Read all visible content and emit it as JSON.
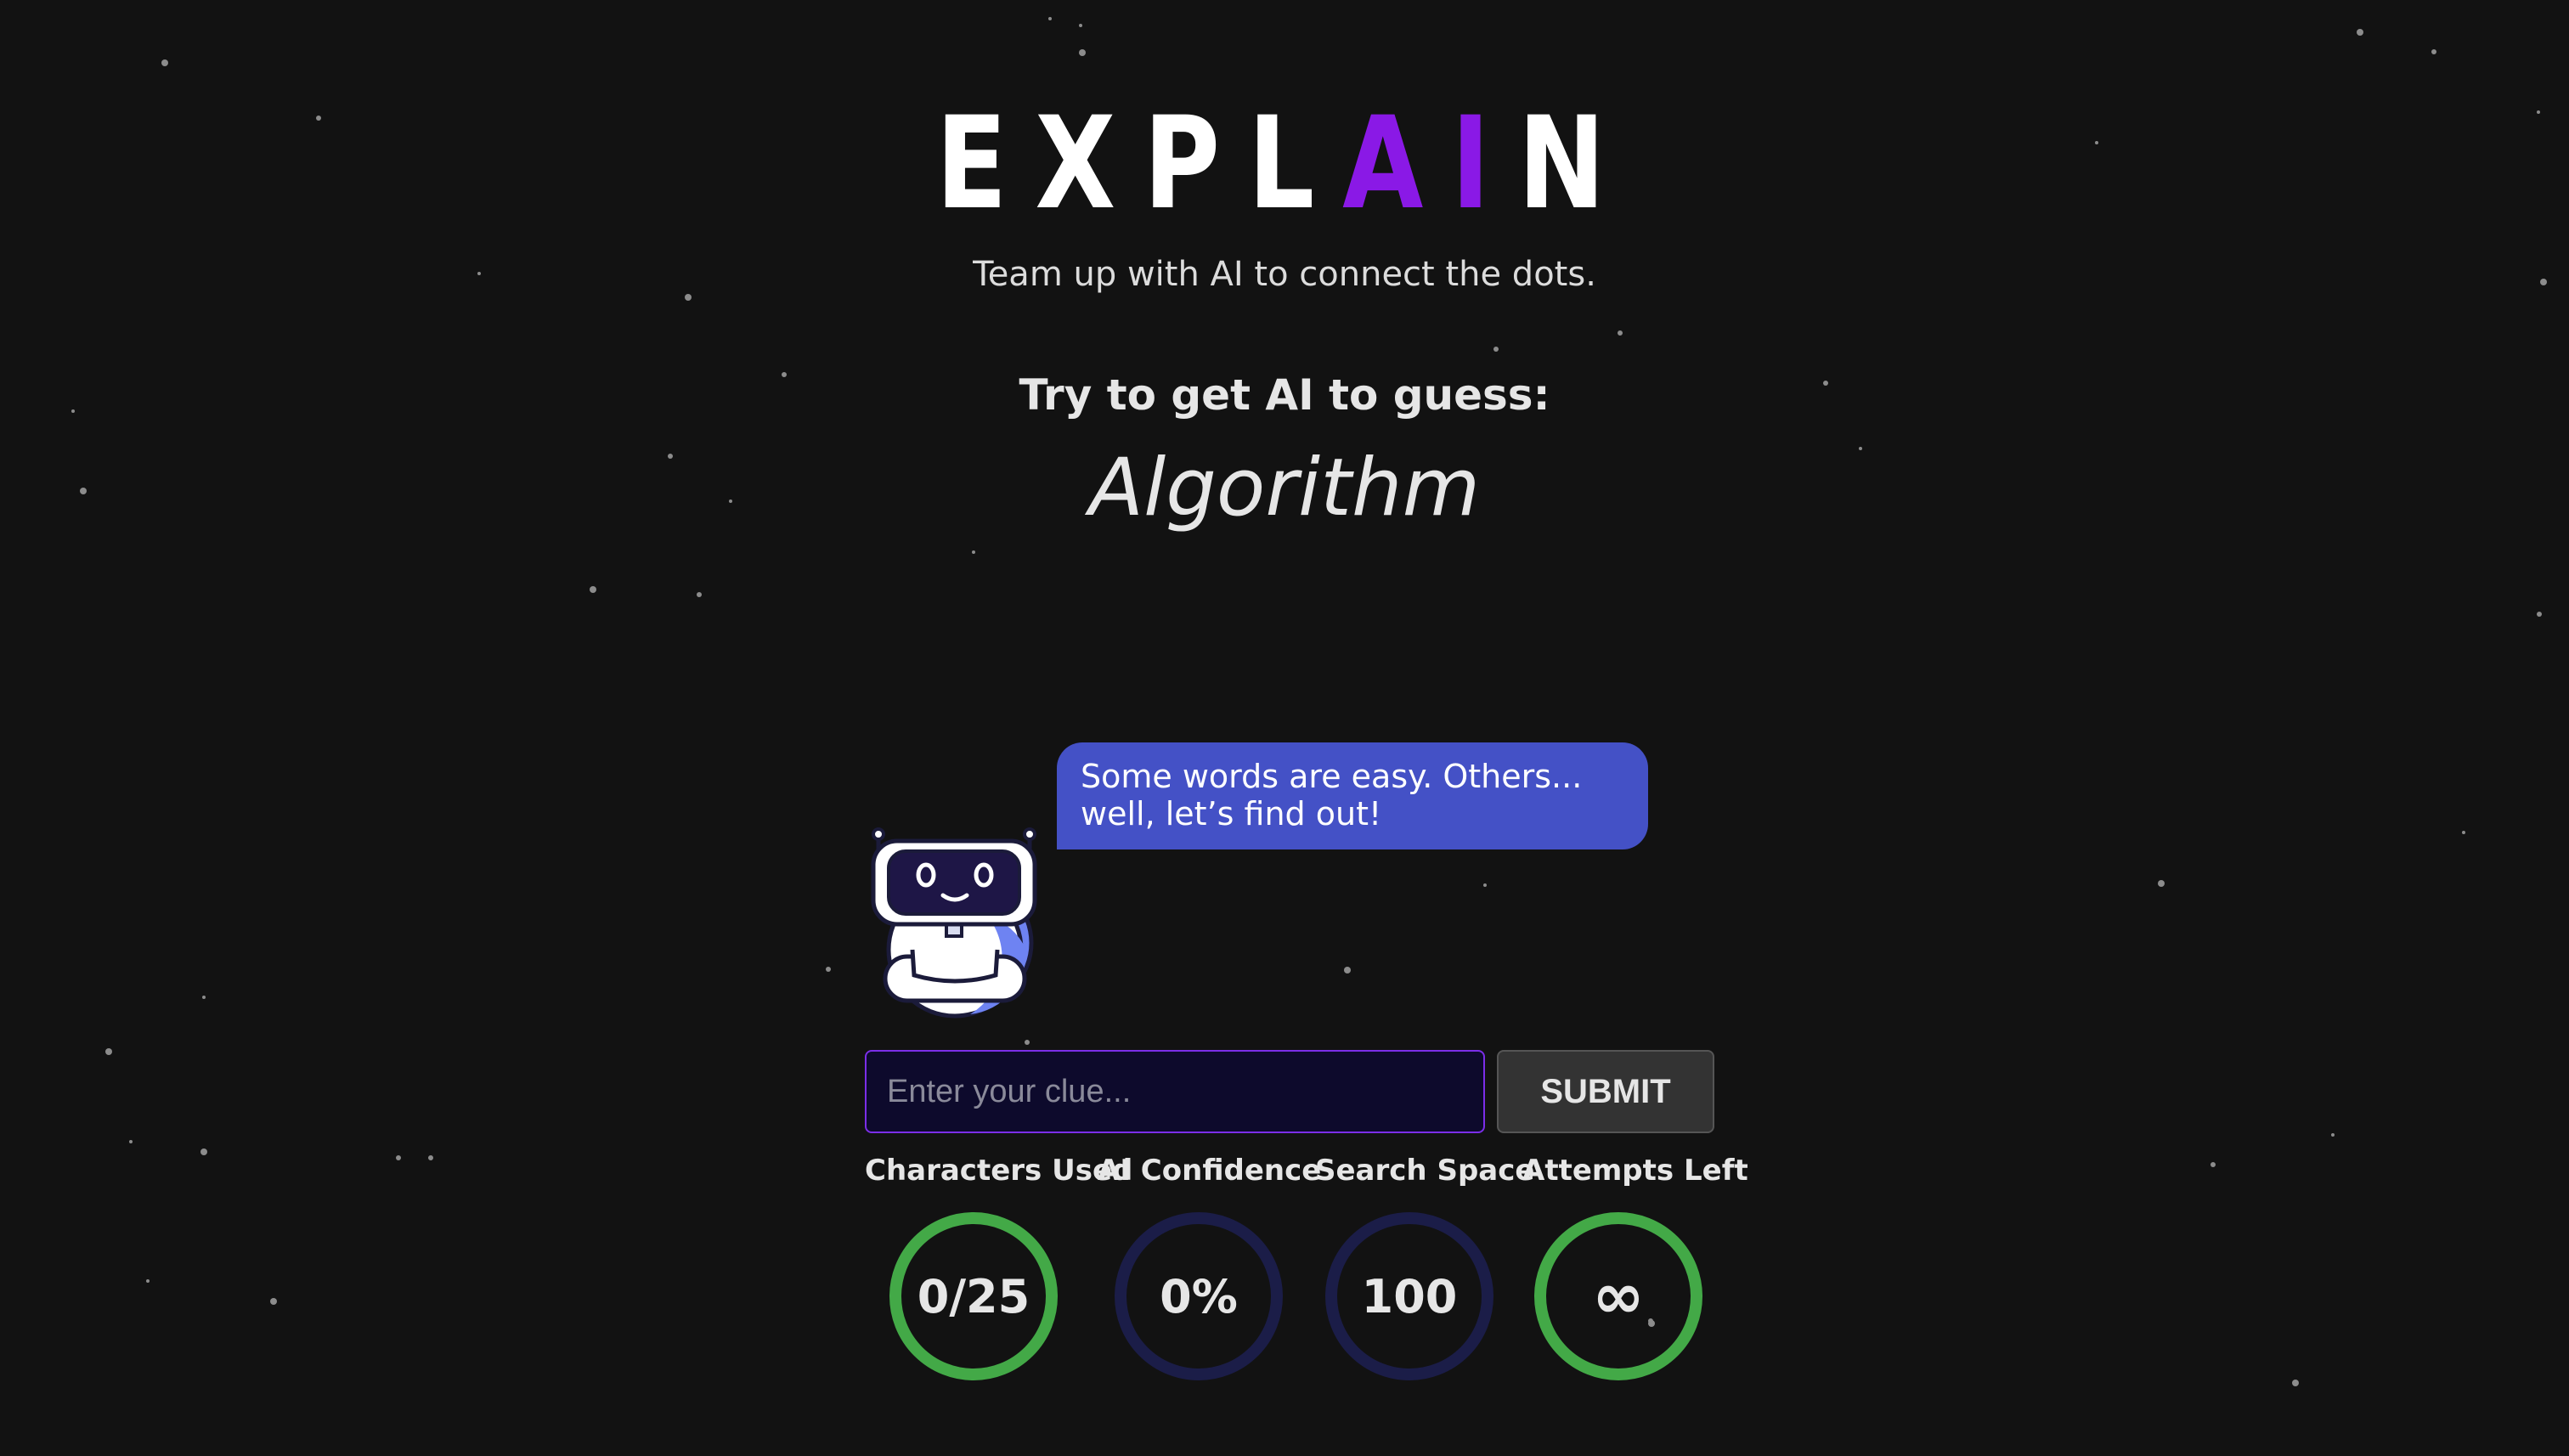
{
  "header": {
    "logo_prefix": "EXPL",
    "logo_accent": "AI",
    "logo_suffix": "N",
    "tagline": "Team up with AI to connect the dots."
  },
  "challenge": {
    "prompt": "Try to get AI to guess:",
    "target_word": "Algorithm"
  },
  "assistant": {
    "message_line1": "Some words are easy. Others...",
    "message_line2": "well, let’s find out!"
  },
  "clue_form": {
    "placeholder": "Enter your clue...",
    "value": "",
    "submit_label": "SUBMIT"
  },
  "stats": [
    {
      "label": "Characters Used",
      "value": "0/25",
      "status": "active"
    },
    {
      "label": "AI Confidence",
      "value": "0%",
      "status": "inactive"
    },
    {
      "label": "Search Space",
      "value": "100",
      "status": "inactive"
    },
    {
      "label": "Attempts Left",
      "value": "∞",
      "status": "active",
      "icon": "infinity-icon"
    }
  ],
  "colors": {
    "background": "#121212",
    "logo_accent": "#8a19e6",
    "bubble": "#4451c6",
    "input_bg": "#0d0a2c",
    "input_border": "#7b2ee8",
    "ring_active": "#43a947",
    "ring_inactive": "#1b1d48"
  }
}
